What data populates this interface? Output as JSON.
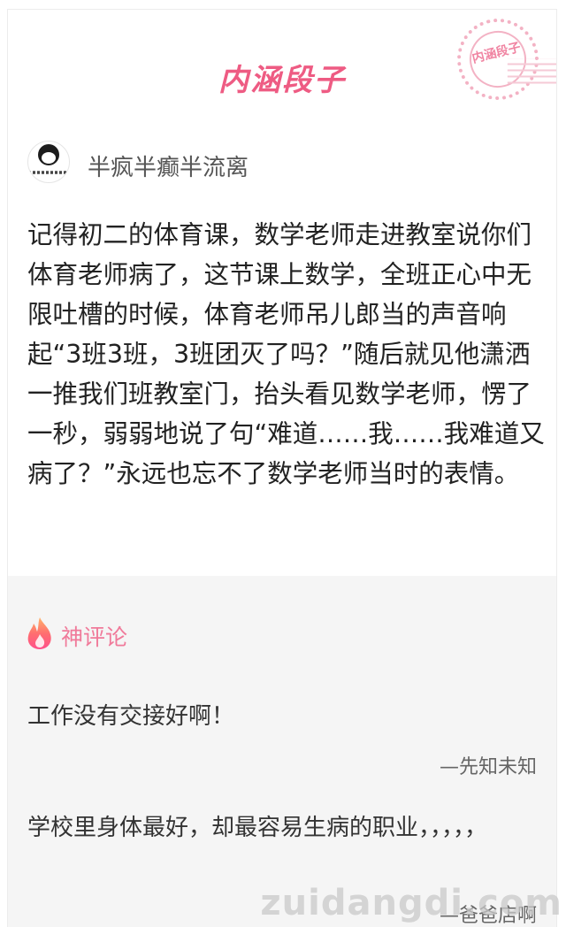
{
  "header": {
    "brand": "内涵段子",
    "stamp_text": "内涵段子"
  },
  "author": {
    "name": "半疯半癫半流离"
  },
  "post": {
    "text": "记得初二的体育课，数学老师走进教室说你们体育老师病了，这节课上数学，全班正心中无限吐槽的时候，体育老师吊儿郎当的声音响起“3班3班，3班团灭了吗？”随后就见他潇洒一推我们班教室门，抬头看见数学老师，愣了一秒，弱弱地说了句“难道……我……我难道又病了？”永远也忘不了数学老师当时的表情。"
  },
  "comments": {
    "title": "神评论",
    "items": [
      {
        "text": "工作没有交接好啊！",
        "author": "—先知未知"
      },
      {
        "text": "学校里身体最好，却最容易生病的职业，，，，，",
        "author": "—爸爸店啊"
      }
    ]
  },
  "watermark": "zuidangdi.com",
  "colors": {
    "brand_pink": "#ee5b83",
    "comment_title": "#f07a9a",
    "comments_bg": "#f5f5f5"
  },
  "icons": {
    "comments_title_icon": "flame-icon"
  }
}
